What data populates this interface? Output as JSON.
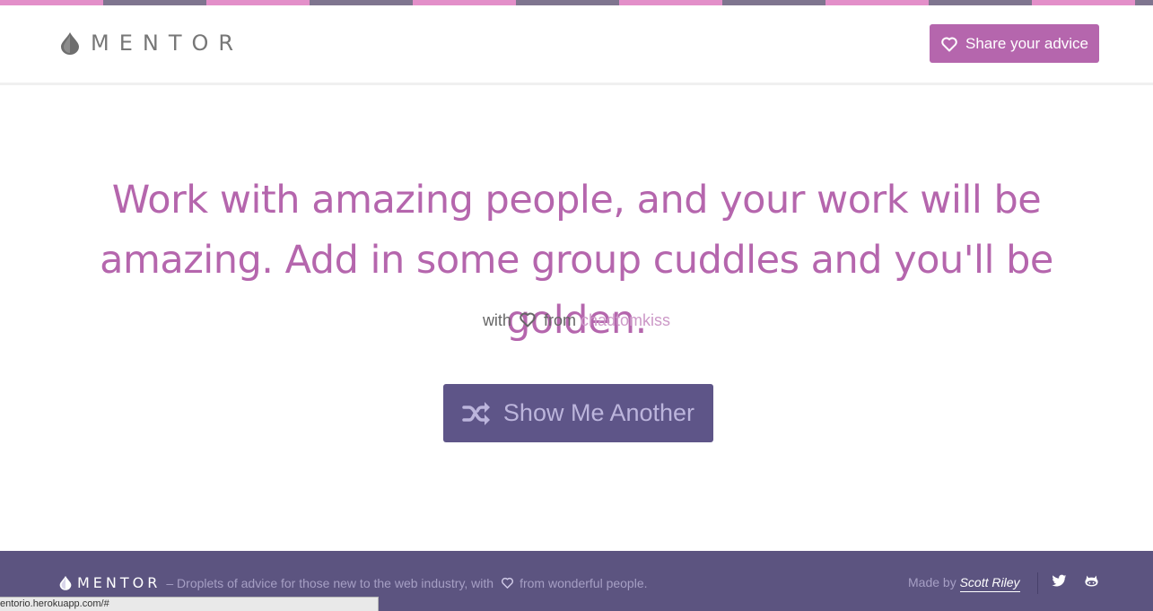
{
  "brand": {
    "wordmark": "MENTOR",
    "icon": "droplet-icon"
  },
  "colors": {
    "pink": "#e38fc9",
    "gray": "#7f758f",
    "accent": "#b566ad",
    "button": "#5e5588",
    "footer": "#5c5480",
    "link": "#cc99c7"
  },
  "header": {
    "share_label": "Share your advice",
    "share_icon": "heart-outline-icon"
  },
  "advice": {
    "quote": "Work with amazing people, and your work will be amazing. Add in some group cuddles and you'll be golden.",
    "with_label": "with",
    "from_label": "from",
    "author": "chadtomkiss"
  },
  "actions": {
    "show_another_label": "Show Me Another",
    "show_another_icon": "shuffle-icon"
  },
  "footer": {
    "wordmark": "MENTOR",
    "tagline_before": "– Droplets of advice for those new to the web industry, with",
    "tagline_after": "from wonderful people.",
    "made_by_label": "Made by",
    "made_by_name": "Scott Riley",
    "social_icons": [
      "twitter-icon",
      "github-icon"
    ]
  },
  "status_bar": {
    "url": "entorio.herokuapp.com/#"
  }
}
